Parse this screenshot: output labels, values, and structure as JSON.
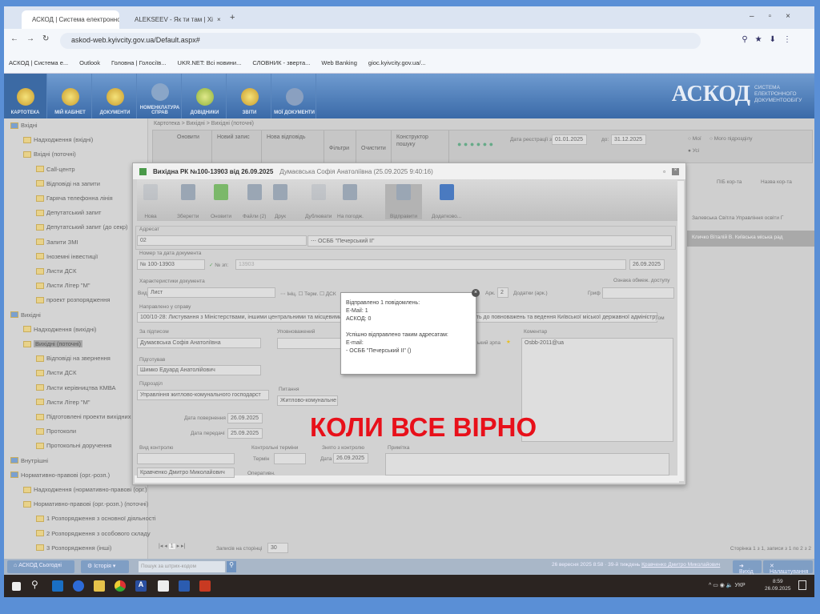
{
  "browser": {
    "tabs": [
      {
        "label": "АСКОД | Система електронно"
      },
      {
        "label": "ALEKSEEV - Як ти там | Хі"
      }
    ],
    "url": "askod-web.kyivcity.gov.ua/Default.aspx#",
    "bookmarks": [
      "АСКОД | Система е...",
      "Outlook",
      "Головна | Голосіїв...",
      "UKR.NET: Всі новини...",
      "СЛОВНИК - зверта...",
      "Web Banking",
      "gioc.kyivcity.gov.ua/..."
    ]
  },
  "app": {
    "nav": [
      "КАРТОТЕКА",
      "МІЙ КАБІНЕТ",
      "ДОКУМЕНТИ",
      "НОМЕНКЛАТУРА СПРАВ",
      "ДОВІДНИКИ",
      "ЗВІТИ",
      "МОЇ ДОКУМЕНТИ"
    ],
    "logo": "АСКОД",
    "logo_sub": "СИСТЕМА ЕЛЕКТРОННОГО ДОКУМЕНТООБІГУ"
  },
  "tree": [
    {
      "label": "Вхідні",
      "level": 0
    },
    {
      "label": "Надходження (вхідні)",
      "level": 1
    },
    {
      "label": "Вхідні (поточні)",
      "level": 1
    },
    {
      "label": "Call-центр",
      "level": 2
    },
    {
      "label": "Відповіді на запити",
      "level": 2
    },
    {
      "label": "Гаряча телефонна лінія",
      "level": 2
    },
    {
      "label": "Депутатський запит",
      "level": 2
    },
    {
      "label": "Депутатський запит (до секр)",
      "level": 2
    },
    {
      "label": "Запити ЗМІ",
      "level": 2
    },
    {
      "label": "Іноземні інвестиції",
      "level": 2
    },
    {
      "label": "Листи ДСК",
      "level": 2
    },
    {
      "label": "Листи Літер \"М\"",
      "level": 2
    },
    {
      "label": "проект розпорядження",
      "level": 2
    },
    {
      "label": "Вихідні",
      "level": 0
    },
    {
      "label": "Надходження (вихідні)",
      "level": 1
    },
    {
      "label": "Вихідні (поточні)",
      "level": 1,
      "selected": true
    },
    {
      "label": "Відповіді на звернення",
      "level": 2
    },
    {
      "label": "Листи ДСК",
      "level": 2
    },
    {
      "label": "Листи керівництва КМВА",
      "level": 2
    },
    {
      "label": "Листи Літер \"М\"",
      "level": 2
    },
    {
      "label": "Підготовлені проекти вихідних",
      "level": 2
    },
    {
      "label": "Протоколи",
      "level": 2
    },
    {
      "label": "Протокольні доручення",
      "level": 2
    },
    {
      "label": "Внутрішні",
      "level": 0
    },
    {
      "label": "Нормативно-правові (орг.-розп.)",
      "level": 0
    },
    {
      "label": "Надходження (нормативно-правові (орг.)",
      "level": 1
    },
    {
      "label": "Нормативно-правові (орг.-розп.) (поточні)",
      "level": 1
    },
    {
      "label": "1 Розпорядження з основної діяльності",
      "level": 2
    },
    {
      "label": "2 Розпорядження з особового складу",
      "level": 2
    },
    {
      "label": "3 Розпорядження (інші)",
      "level": 2
    }
  ],
  "main": {
    "breadcrumb": "Картотека > Вихідні > Вихідні (поточні)",
    "toolbar": [
      "Оновити",
      "Новий запис",
      "Нова відповідь",
      "Фільтри",
      "Очистити",
      "Конструктор пошуку"
    ],
    "date_from_label": "Дата реєстрації з:",
    "date_from": "01.01.2025",
    "date_to_label": "до:",
    "date_to": "31.12.2025",
    "radios": [
      "Мої",
      "Мого підрозділу",
      "Усі"
    ],
    "columns": [
      "ПІБ кор-та",
      "Назва кор-та"
    ],
    "rows": [
      [
        "Залевська Світла",
        "Управління освіти Г"
      ],
      [
        "Кличко Віталій В.",
        "Київська міська рад"
      ]
    ],
    "pager_page": "1",
    "per_page_label": "Записів на сторінці",
    "per_page": "30",
    "page_info": "Сторінка 1 з 1, записи з 1 по 2 з 2"
  },
  "dialog": {
    "title": "Вихідна РК №100-13903 від 26.09.2025",
    "subtitle": "Думаєвська Софія Анатоліївна (25.09.2025 9:40:16)",
    "toolbar": [
      "Нова",
      "Зберегти",
      "Оновити",
      "Файли (2)",
      "Друк",
      "Дублювати",
      "На погодж.",
      "Відправити",
      "Додатково..."
    ],
    "addressee_label": "Адресат",
    "addressee_code": "02",
    "addressee_name": "ОСББ \"Печерський II\"",
    "num_label": "Номер та дата документа",
    "num": "№ 100-13903",
    "ext_label": "№ зп:",
    "ext": "13903",
    "doc_date": "26.09.2025",
    "char_label": "Характеристики документа",
    "kind_label": "Вид",
    "kind": "Лист",
    "inic": "Ініц.",
    "term": "Терм.",
    "dsk": "ДСК",
    "arch_label": "Арк.",
    "arch": "2",
    "attach_label": "Додатки (арк.)",
    "access_label": "Ознака обмеж. доступу",
    "grif_label": "Гриф",
    "case_label": "Направлено у справу",
    "case": "100/10-28: Листування з Міністерствами, іншими центральними та місцевими органами виконавчої влади ... з питань, що належать до повноважень та ведення Київської міської державної адміністрації з питань, що потребують погодження та упередження (окрім Київської міської ради), об'єднаннями гром",
    "tom_label": "Том",
    "signer_label": "За підписом",
    "signer": "Думаєвська Софія Анатоліївна",
    "auth_label": "Уповноважений",
    "prep_label": "Підготував",
    "prep": "Шимко Едуард Анатолійович",
    "dept_label": "Підрозділ",
    "dept": "Управління житлово-комунального господарст",
    "topic_label": "Питання",
    "topic": "Житлово-комунальне г",
    "ret_label": "Дата повернення",
    "ret": "26.09.2025",
    "trans_label": "Дата передачі",
    "trans": "25.09.2025",
    "recipient_tail": "ький зрпа",
    "comment_label": "Коментар",
    "comment": "Osbb-2011@ua",
    "ctrl_label": "Вид контролю",
    "ctrl_terms_label": "Контрольні терміни",
    "term_label": "Термін",
    "oper_label": "Оперативн.",
    "removed_label": "Знято з контролю",
    "date_label": "Дата",
    "removed_date": "26.09.2025",
    "note_label": "Примітка",
    "controller": "Кравченко Дмитро Миколайович"
  },
  "popup": {
    "lines": [
      "Відправлено 1 повідомлень:",
      "E-Mail: 1",
      "АСКОД: 0",
      "",
      "Успішно відправлено таким адресатам:",
      "E-mail:",
      "- ОСББ \"Печерський II\" ()"
    ]
  },
  "overlay_text": "КОЛИ ВСЕ ВІРНО",
  "appbar": {
    "home": "АСКОД Сьогодні",
    "history": "Історія",
    "barcode_placeholder": "Пошук за штрих-кодом",
    "status": "26 вересня 2025 8:58 · 39-й тиждень",
    "user": "Кравченко Дмитро Миколайович",
    "exit": "Вихід",
    "settings": "Налаштування"
  },
  "taskbar": {
    "time": "8:59",
    "date": "26.09.2025",
    "lang": "УКР"
  }
}
